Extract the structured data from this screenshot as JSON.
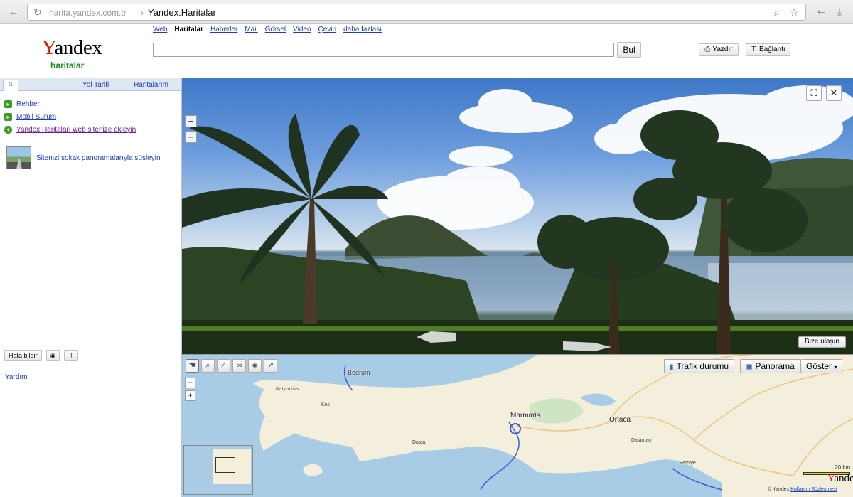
{
  "browser": {
    "url": "harita.yandex.com.tr",
    "separator": "›",
    "title": "Yandex.Haritalar"
  },
  "header": {
    "logo_prefix": "Y",
    "logo_rest": "andex",
    "logo_sub": "haritalar",
    "services": [
      "Web",
      "Haritalar",
      "Haberler",
      "Mail",
      "Görsel",
      "Video",
      "Çeviri",
      "daha fazlası"
    ],
    "active_service": "Haritalar",
    "search_value": "",
    "find_label": "Bul",
    "print_label": "Yazdır",
    "link_label": "Bağlantı"
  },
  "left_panel": {
    "tabs": [
      "Yol Tarifi",
      "Haritalarım"
    ],
    "menu": [
      {
        "label": "Rehber"
      },
      {
        "label": "Mobil Sürüm"
      },
      {
        "label": "Yandex.Haritaları web sitenize ekleyin"
      }
    ],
    "pano_promo": "Sitenizi sokak panoramalarıyla süsleyin",
    "report_label": "Hata bildir",
    "help_label": "Yardım"
  },
  "panorama": {
    "contact_label": "Bize ulaşın"
  },
  "map": {
    "layers": {
      "traffic": "Trafik durumu",
      "panorama": "Panorama",
      "show": "Göster"
    },
    "places": [
      "Bodrum",
      "Katyrmisis",
      "Kos",
      "Marmaris",
      "Ortaca",
      "Datça",
      "Dalaman",
      "Fethiye"
    ],
    "scale_label": "20 km",
    "logo_prefix": "Y",
    "logo_rest": "andex",
    "footer_copyright": "© Yandex",
    "footer_terms": "Kullanım Sözleşmesi"
  },
  "colors": {
    "link": "#1a3dc1",
    "logo_red": "#e61400",
    "logo_green": "#1f8f1f",
    "sea": "#a8cbe6",
    "land": "#f3efdc"
  }
}
